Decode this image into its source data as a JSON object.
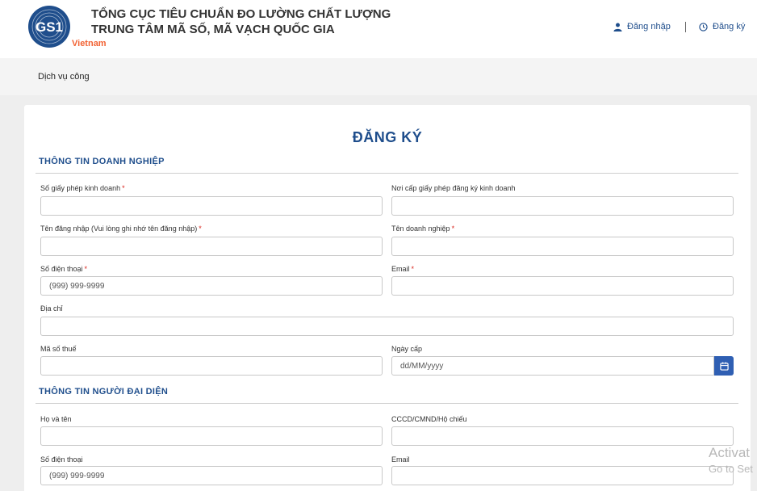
{
  "header": {
    "logo_text": "GS1",
    "logo_country": "Vietnam",
    "org_line1": "TỔNG CỤC TIÊU CHUẨN ĐO LƯỜNG CHẤT LƯỢNG",
    "org_line2": "TRUNG TÂM MÃ SỐ, MÃ VẠCH QUỐC GIA",
    "login_label": "Đăng nhập",
    "register_label": "Đăng ký"
  },
  "nav": {
    "item": "Dịch vụ công"
  },
  "form": {
    "title": "ĐĂNG KÝ",
    "required_mark": "*",
    "section_business": "THÔNG TIN DOANH NGHIỆP",
    "section_rep": "THÔNG TIN NGƯỜI ĐẠI DIỆN",
    "business": {
      "license_no": "Số giấy phép kinh doanh",
      "license_place": "Nơi cấp giấy phép đăng ký kinh doanh",
      "username": "Tên đăng nhập (Vui lòng ghi nhớ tên đăng nhập)",
      "company_name": "Tên doanh nghiệp",
      "phone": "Số điện thoại",
      "phone_placeholder": "(999) 999-9999",
      "email": "Email",
      "address": "Địa chỉ",
      "tax_code": "Mã số thuế",
      "issue_date": "Ngày cấp",
      "issue_date_placeholder": "dd/MM/yyyy"
    },
    "rep": {
      "full_name": "Họ và tên",
      "id_no": "CCCD/CMND/Hộ chiếu",
      "phone": "Số điện thoại",
      "phone_placeholder": "(999) 999-9999",
      "email": "Email"
    }
  },
  "watermark": {
    "line1": "Activat",
    "line2": "Go to Set"
  },
  "colors": {
    "brand_blue": "#1f4e8c",
    "logo_orange": "#f26334",
    "required_red": "#d9251d",
    "button_blue": "#2f5fb3"
  },
  "icons": {
    "login": "user-icon",
    "register": "clock-icon",
    "date_picker": "calendar-icon"
  }
}
